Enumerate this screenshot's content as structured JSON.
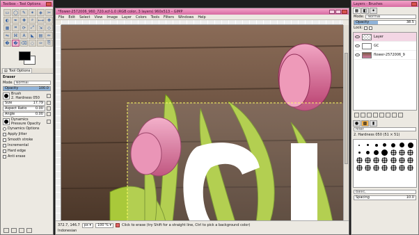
{
  "toolbox": {
    "title": "Toolbox - Tool Options",
    "tools": [
      "rect-select",
      "ellipse-select",
      "free-select",
      "fuzzy-select",
      "by-color-select",
      "scissors",
      "foreground-select",
      "paths",
      "color-picker",
      "zoom",
      "measure",
      "move",
      "align",
      "crop",
      "rotate",
      "scale",
      "shear",
      "perspective",
      "flip",
      "cage",
      "text",
      "bucket-fill",
      "blend",
      "pencil",
      "paintbrush",
      "eraser",
      "airbrush",
      "ink",
      "clone",
      "heal"
    ],
    "options_tab": "Tool Options",
    "eraser": {
      "title": "Eraser",
      "mode_label": "Mode",
      "mode_value": "Normal",
      "opacity_label": "Opacity",
      "opacity_value": "100.0",
      "opacity_fraction": 1.0,
      "brush_label": "Brush",
      "brush_value": "2. Hardness 050",
      "size_label": "Size",
      "size_value": "17.79",
      "aspect_label": "Aspect Ratio",
      "aspect_value": "0.00",
      "angle_label": "Angle",
      "angle_value": "0.00",
      "dynamics_label": "Dynamics",
      "dynamics_value": "Pressure Opacity",
      "dyn_options": "Dynamics Options",
      "apply_jitter": "Apply Jitter",
      "smooth_stroke": "Smooth stroke",
      "incremental": "Incremental",
      "hard_edge": "Hard edge",
      "anti_erase": "Anti erase"
    }
  },
  "image_window": {
    "title": "*flower-2572006_960_720.xcf-1.0 (RGB color, 3 layers) 960x513 – GIMP",
    "menu": [
      "File",
      "Edit",
      "Select",
      "View",
      "Image",
      "Layer",
      "Colors",
      "Tools",
      "Filters",
      "Windows",
      "Help"
    ],
    "status": {
      "coords": "372.7, 146.7",
      "unit": "px",
      "zoom": "100 %",
      "message": "Click to erase (try Shift for a straight line, Ctrl to pick a background color)",
      "language": "Indonesian"
    }
  },
  "layers_panel": {
    "title": "Layers - Brushes",
    "mode_label": "Mode:",
    "mode_value": "Normal",
    "opacity_label": "Opacity",
    "opacity_value": "38.5",
    "opacity_fraction": 0.385,
    "lock_label": "Lock:",
    "layers": [
      {
        "name": "Layer"
      },
      {
        "name": "GC"
      },
      {
        "name": "flower-2572006_9"
      }
    ],
    "brush_filter": "filter",
    "brush_name": "2. Hardness 050 (51 × 51)",
    "preset_value": "Basic,",
    "spacing_label": "Spacing",
    "spacing_value": "10.0"
  },
  "colors": {
    "accent_title": "#dd77ab",
    "selection": "#ffffff",
    "foreground": "#000000",
    "background": "#ffffff"
  }
}
